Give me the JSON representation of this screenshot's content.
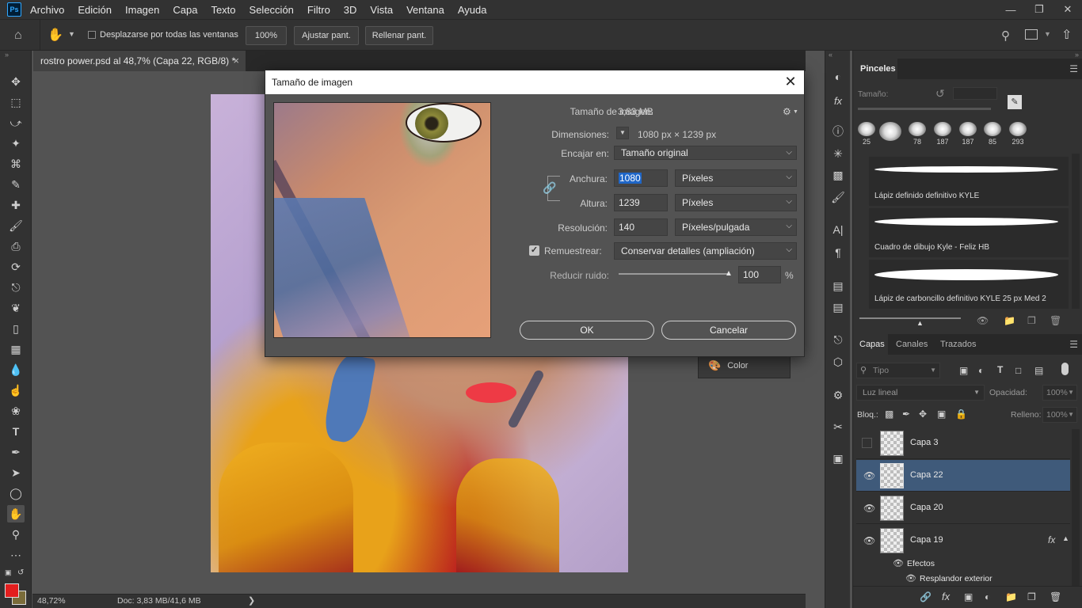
{
  "app": {
    "logo": "Ps"
  },
  "menu": [
    "Archivo",
    "Edición",
    "Imagen",
    "Capa",
    "Texto",
    "Selección",
    "Filtro",
    "3D",
    "Vista",
    "Ventana",
    "Ayuda"
  ],
  "options_bar": {
    "scroll_all_label": "Desplazarse por todas las ventanas",
    "zoom_btn": "100%",
    "fit_btn": "Ajustar pant.",
    "fill_btn": "Rellenar pant."
  },
  "document_tab": {
    "title": "rostro power.psd al 48,7% (Capa 22, RGB/8) *",
    "close": "×"
  },
  "status": {
    "zoom": "48,72%",
    "doc": "Doc: 3,83 MB/41,6 MB"
  },
  "color_panel": {
    "label": "Color"
  },
  "brushes_panel": {
    "title": "Pinceles",
    "size_label": "Tamaño:",
    "presets": [
      "25",
      "",
      "78",
      "187",
      "187",
      "85",
      "293"
    ],
    "brushes": [
      "Lápiz definido definitivo KYLE",
      "Cuadro de dibujo Kyle - Feliz HB",
      "Lápiz de carboncillo definitivo KYLE 25 px Med 2"
    ]
  },
  "layers_panel": {
    "tabs": [
      "Capas",
      "Canales",
      "Trazados"
    ],
    "search_placeholder": "Tipo",
    "blend_mode": "Luz lineal",
    "opacity_label": "Opacidad:",
    "opacity_value": "100%",
    "lock_label": "Bloq.:",
    "fill_label": "Relleno:",
    "fill_value": "100%",
    "layers": [
      "Capa 3",
      "Capa 22",
      "Capa 20",
      "Capa 19"
    ],
    "effects_label": "Efectos",
    "effect_item": "Resplandor exterior"
  },
  "dialog": {
    "title": "Tamaño de imagen",
    "size_label": "Tamaño de imagen:",
    "size_value": "3,83 MB",
    "dimensions_label": "Dimensiones:",
    "dimensions_value": "1080 px × 1239 px",
    "fit_label": "Encajar en:",
    "fit_value": "Tamaño original",
    "width_label": "Anchura:",
    "width_value": "1080",
    "width_unit": "Píxeles",
    "height_label": "Altura:",
    "height_value": "1239",
    "height_unit": "Píxeles",
    "resolution_label": "Resolución:",
    "resolution_value": "140",
    "resolution_unit": "Píxeles/pulgada",
    "resample_label": "Remuestrear:",
    "resample_value": "Conservar detalles (ampliación)",
    "noise_label": "Reducir ruido:",
    "noise_value": "100",
    "noise_unit": "%",
    "ok": "OK",
    "cancel": "Cancelar"
  }
}
